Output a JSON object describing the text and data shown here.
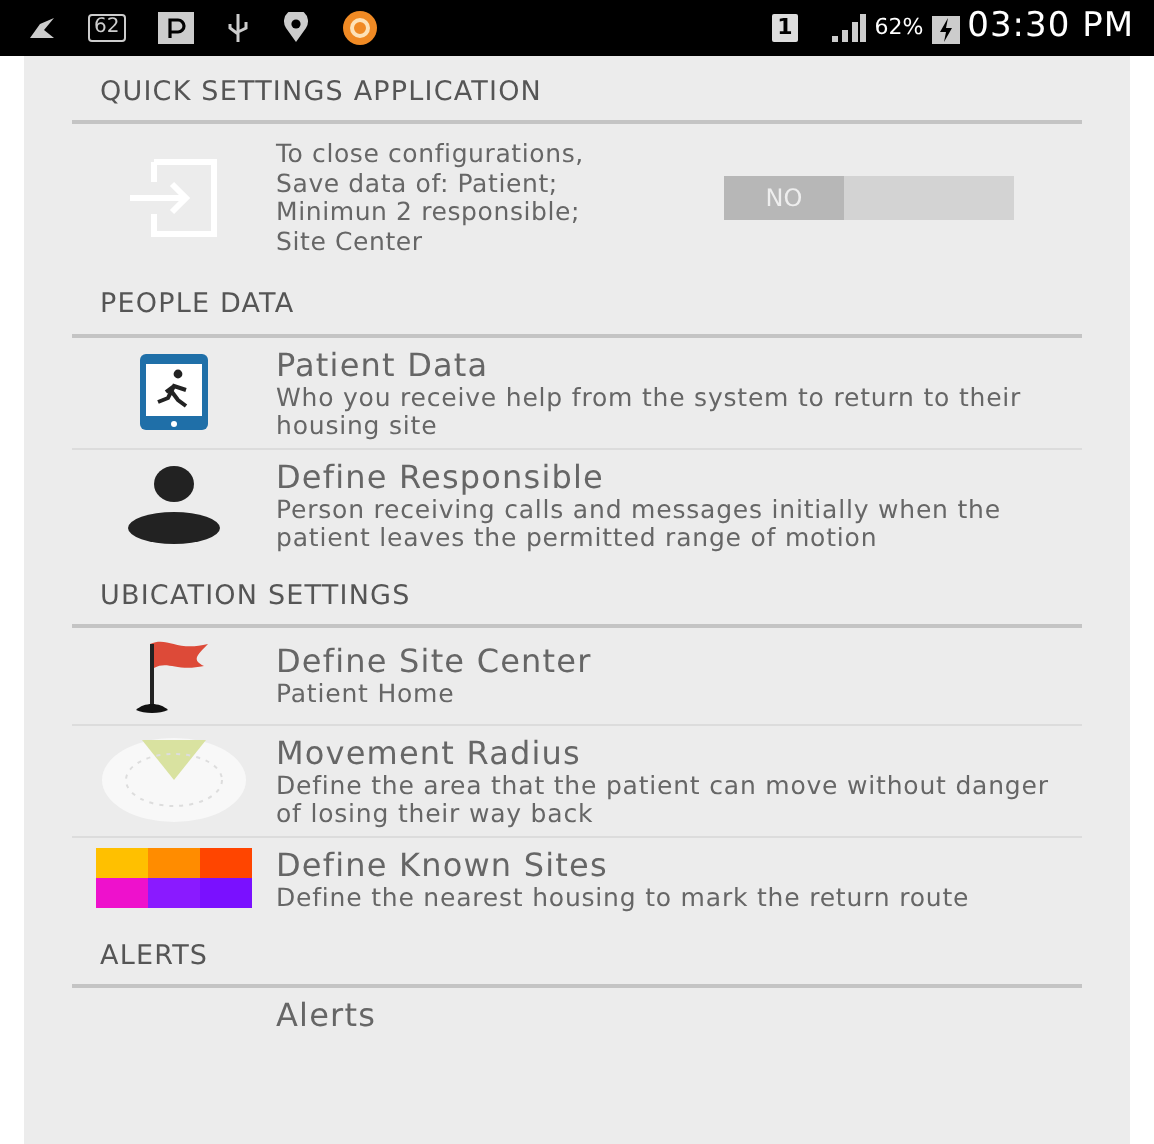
{
  "status_bar": {
    "notification_count": "62",
    "sim_slot": "1",
    "battery": "62%",
    "time": "03:30 PM"
  },
  "sections": [
    {
      "title": "QUICK SETTINGS APPLICATION",
      "items": [
        {
          "kind": "toggle",
          "description": "To close configurations, Save data of: Patient; Minimun 2 responsible; Site Center",
          "toggle": {
            "label": "NO",
            "on": false
          }
        }
      ]
    },
    {
      "title": "PEOPLE DATA",
      "items": [
        {
          "kind": "link",
          "title": "Patient Data",
          "description": "Who you receive help from the system to return to their housing site"
        },
        {
          "kind": "link",
          "title": "Define Responsible",
          "description": "Person receiving calls and messages initially when the patient leaves the permitted range of motion"
        }
      ]
    },
    {
      "title": "UBICATION SETTINGS",
      "items": [
        {
          "kind": "link",
          "title": "Define Site Center",
          "description": "Patient Home"
        },
        {
          "kind": "link",
          "title": "Movement Radius",
          "description": "Define the area that the patient can move without danger of losing their way back"
        },
        {
          "kind": "link",
          "title": "Define Known Sites",
          "description": "Define the nearest housing to mark the return route"
        }
      ]
    },
    {
      "title": "ALERTS",
      "items": [
        {
          "kind": "title_only",
          "title": "Alerts"
        }
      ]
    }
  ]
}
